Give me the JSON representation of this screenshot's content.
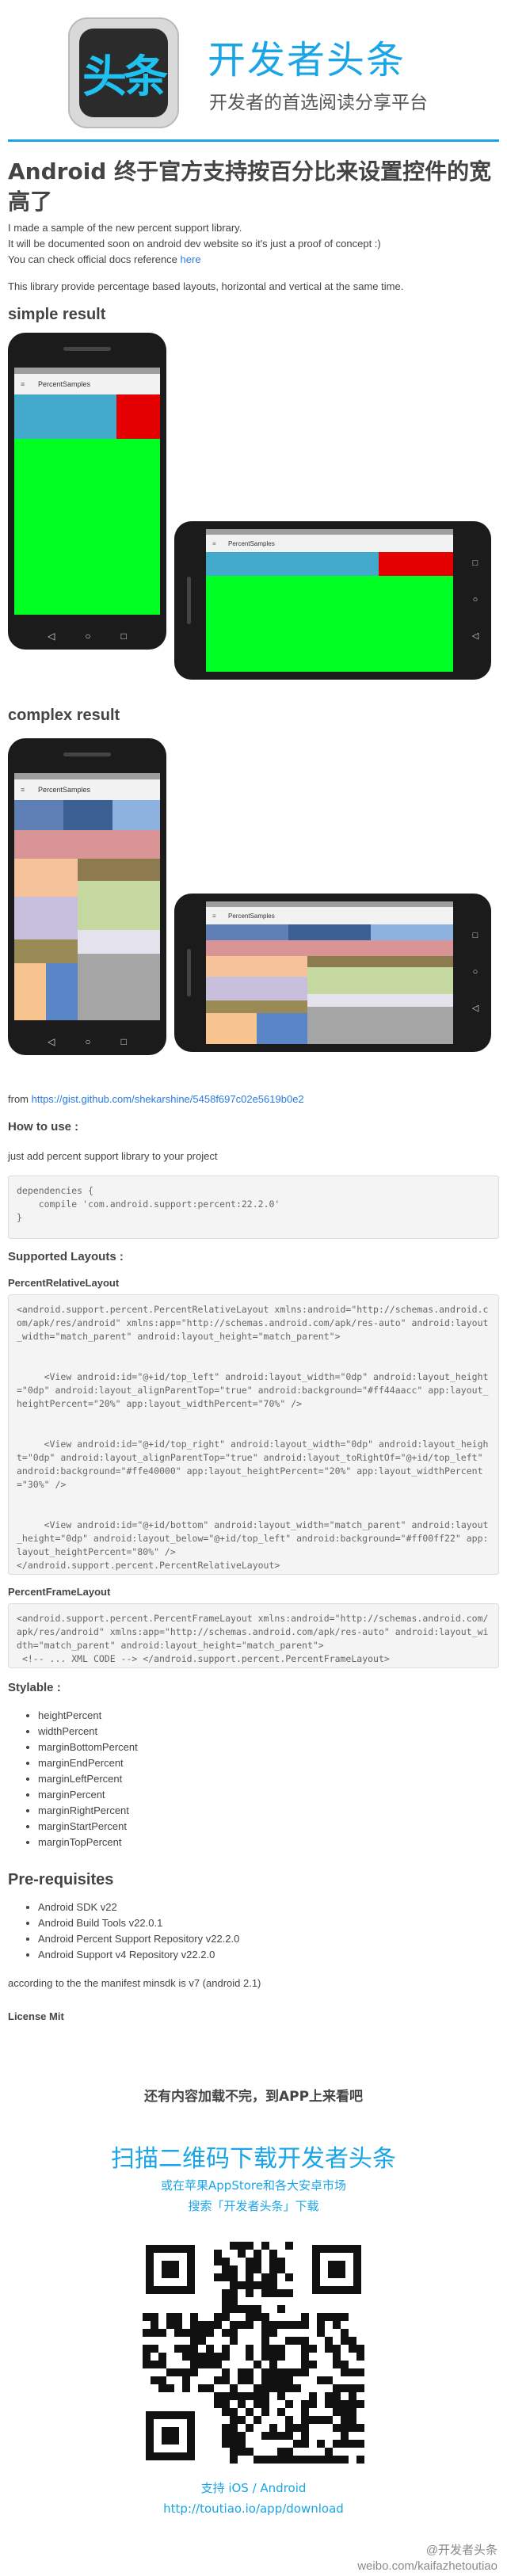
{
  "header": {
    "logo_text": "头条",
    "brand_title": "开发者头条",
    "brand_subtitle": "开发者的首选阅读分享平台"
  },
  "article": {
    "title": "Android 终于官方支持按百分比来设置控件的宽高了",
    "intro_line1": "I made a sample of the new percent support library.",
    "intro_line2": "It will be documented soon on android dev website so it's just a proof of concept :)",
    "intro_line3_prefix": "You can check official docs reference",
    "intro_line3_link": "here",
    "description": "This library provide percentage based layouts, horizontal and vertical at the same time.",
    "simple_result_heading": "simple result",
    "complex_result_heading": "complex result",
    "app_bar_title": "PercentSamples",
    "from_prefix": "from",
    "from_link": "https://gist.github.com/shekarshine/5458f697c02e5619b0e2",
    "how_to_use_heading": "How to use :",
    "how_to_use_text": "just add percent support library to your project",
    "dependencies_code": "dependencies {\n    compile 'com.android.support:percent:22.2.0'\n}",
    "supported_layouts_heading": "Supported Layouts :",
    "relative_layout_heading": "PercentRelativeLayout",
    "relative_layout_code": "<android.support.percent.PercentRelativeLayout xmlns:android=\"http://schemas.android.com/apk/res/android\" xmlns:app=\"http://schemas.android.com/apk/res-auto\" android:layout_width=\"match_parent\" android:layout_height=\"match_parent\">\n\n\n     <View android:id=\"@+id/top_left\" android:layout_width=\"0dp\" android:layout_height=\"0dp\" android:layout_alignParentTop=\"true\" android:background=\"#ff44aacc\" app:layout_heightPercent=\"20%\" app:layout_widthPercent=\"70%\" />\n\n\n     <View android:id=\"@+id/top_right\" android:layout_width=\"0dp\" android:layout_height=\"0dp\" android:layout_alignParentTop=\"true\" android:layout_toRightOf=\"@+id/top_left\" android:background=\"#ffe40000\" app:layout_heightPercent=\"20%\" app:layout_widthPercent=\"30%\" />\n\n\n     <View android:id=\"@+id/bottom\" android:layout_width=\"match_parent\" android:layout_height=\"0dp\" android:layout_below=\"@+id/top_left\" android:background=\"#ff00ff22\" app:layout_heightPercent=\"80%\" />\n</android.support.percent.PercentRelativeLayout>",
    "frame_layout_heading": "PercentFrameLayout",
    "frame_layout_code": "<android.support.percent.PercentFrameLayout xmlns:android=\"http://schemas.android.com/apk/res/android\" xmlns:app=\"http://schemas.android.com/apk/res-auto\" android:layout_width=\"match_parent\" android:layout_height=\"match_parent\">\n <!-- ... XML CODE --> </android.support.percent.PercentFrameLayout>",
    "stylable_heading": "Stylable :",
    "stylable_items": [
      "heightPercent",
      "widthPercent",
      "marginBottomPercent",
      "marginEndPercent",
      "marginLeftPercent",
      "marginPercent",
      "marginRightPercent",
      "marginStartPercent",
      "marginTopPercent"
    ],
    "prerequisites_heading": "Pre-requisites",
    "prerequisites_items": [
      "Android SDK v22",
      "Android Build Tools v22.0.1",
      "Android Percent Support Repository v22.2.0",
      "Android Support v4 Repository v22.2.0"
    ],
    "manifest_note": "according to the the manifest minsdk is v7 (android 2.1)",
    "license": "License Mit"
  },
  "footer": {
    "notice": "还有内容加载不完，到APP上来看吧",
    "download_title": "扫描二维码下载开发者头条",
    "download_sub1": "或在苹果AppStore和各大安卓市场",
    "download_sub2": "搜索「开发者头条」下载",
    "support": "支持 iOS / Android",
    "download_url": "http://toutiao.io/app/download",
    "watermark1": "@开发者头条",
    "watermark2": "weibo.com/kaifazhetoutiao"
  },
  "colors": {
    "brand": "#1aa5e6",
    "simple_top_left": "#44aacc",
    "simple_top_right": "#e40000",
    "simple_bottom": "#00ff22"
  }
}
